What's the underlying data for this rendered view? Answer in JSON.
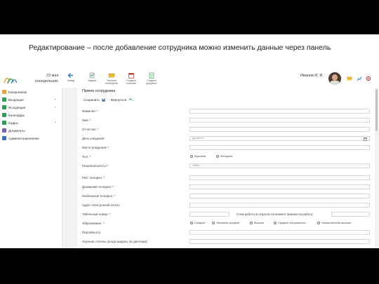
{
  "caption": "Редактирование – после добавление сотрудника можно изменить данные через панель",
  "header": {
    "date_day": "23 мая",
    "date_weekday": "понедельник",
    "toolbar": [
      {
        "icon": "back-arrow-icon",
        "label": "Назад"
      },
      {
        "icon": "tasks-icon",
        "label": "Задачи"
      },
      {
        "icon": "messages-icon",
        "label": "Послать сообщение"
      },
      {
        "icon": "calendar-icon",
        "label": "Создать событие"
      },
      {
        "icon": "document-icon",
        "label": "Создать документ"
      }
    ],
    "user_name": "Иванов И. И."
  },
  "sidebar": {
    "items": [
      {
        "label": "Ежедневник",
        "icon": "diary-icon",
        "color": "#e8a33d"
      },
      {
        "label": "Входящие",
        "icon": "inbox-icon",
        "color": "#2e9e57",
        "expandable": true
      },
      {
        "label": "Исходящие",
        "icon": "outbox-icon",
        "color": "#2e9e57",
        "expandable": true
      },
      {
        "label": "Календарь",
        "icon": "calendar-icon",
        "color": "#2e9e57"
      },
      {
        "label": "Кадры",
        "icon": "staff-icon",
        "color": "#2e9e57",
        "expandable": true
      },
      {
        "label": "Документы",
        "icon": "documents-icon",
        "color": "#7a5bbf"
      },
      {
        "label": "Администрирование",
        "icon": "admin-icon",
        "color": "#3c6fc4"
      }
    ]
  },
  "form": {
    "title": "Прием сотрудника",
    "save_label": "Сохранить",
    "back_label": "Вернуться",
    "fields": {
      "surname": "Фамилия: *",
      "name": "Имя: *",
      "patronymic": "Отчество: *",
      "birthdate": "День рождения:",
      "birthdate_placeholder": "дд.мм.гггг",
      "birthplace": "Место рождения: *",
      "gender": "Пол: *",
      "gender_male": "Мужчина",
      "gender_female": "Женщина",
      "nationality": "Национальность:*",
      "nationality_value": "Узбек",
      "work_phone": "Раб. телефон: *",
      "home_phone": "Домашний телефон: *",
      "mobile_phone": "Мобильный телефон: *",
      "email": "Адрес электронной почты:",
      "tab_number": "Табельный номер: *",
      "experience": "Стаж работы в отрасли на момент приема на работу:",
      "education": "Образование: *",
      "edu_options": [
        "Среднее",
        "Неполное среднее",
        "Высшее",
        "Среднее специальное",
        "Незаконченное высшее"
      ],
      "party": "Партийность:",
      "degree": "Научная степень (когда выдана, № диплома):"
    }
  }
}
